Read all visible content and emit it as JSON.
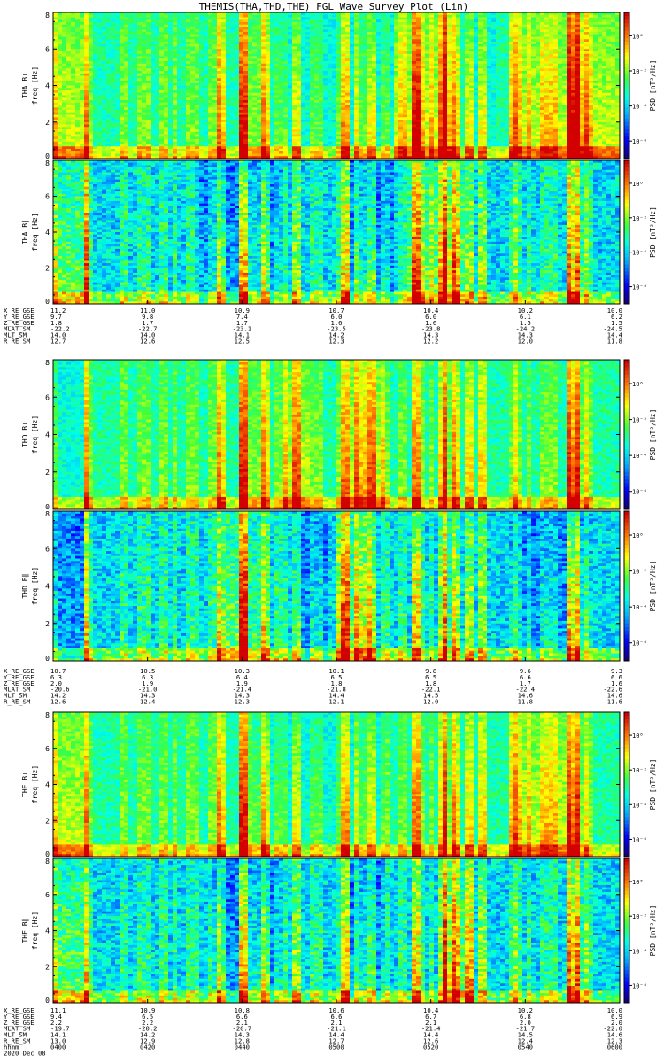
{
  "title": "THEMIS(THA,THD,THE) FGL Wave Survey Plot (Lin)",
  "colorbar_label": "PSD [nT²/Hz]",
  "colorbar_ticks": [
    "10⁰",
    "10⁻²",
    "10⁻⁴",
    "10⁻⁶"
  ],
  "chart_data": {
    "type": "heatmap",
    "colorscale": "rainbow",
    "zscale": "log",
    "ylim": [
      0,
      8
    ],
    "yticks": [
      "0",
      "2",
      "4",
      "6",
      "8"
    ],
    "groups": [
      {
        "probe": "THA",
        "panels": [
          {
            "id": "tha-bl",
            "ylabel": [
              "THA B⊥",
              "freq [Hz]"
            ],
            "component": "perp",
            "quiet_ranges": [
              [
                0.39,
                0.6
              ],
              [
                0.72,
                0.78
              ]
            ],
            "active_ranges": [
              [
                0.0,
                0.05
              ],
              [
                0.6,
                0.7
              ],
              [
                0.8,
                1.0
              ]
            ]
          },
          {
            "id": "tha-bll",
            "ylabel": [
              "THA B∥",
              "freq [Hz]"
            ],
            "component": "par",
            "quiet_ranges": [
              [
                0.25,
                0.4
              ],
              [
                0.52,
                0.6
              ]
            ],
            "active_ranges": [
              [
                0.0,
                0.06
              ],
              [
                0.62,
                0.72
              ]
            ]
          }
        ],
        "ephem_labels": [
          "X_RE_GSE",
          "Y_RE_GSE",
          "Z_RE_GSE",
          "MLAT_SM",
          "MLT_SM",
          "R_RE_SM"
        ],
        "ephem_columns": [
          [
            "11.2",
            "9.7",
            "1.8",
            "-22.2",
            "14.0",
            "12.7"
          ],
          [
            "11.0",
            "9.8",
            "1.7",
            "-22.7",
            "14.0",
            "12.6"
          ],
          [
            "10.9",
            "7.4",
            "1.7",
            "-23.1",
            "14.1",
            "12.5"
          ],
          [
            "10.7",
            "6.0",
            "1.6",
            "-23.5",
            "14.2",
            "12.3"
          ],
          [
            "10.4",
            "6.0",
            "1.6",
            "-23.8",
            "14.3",
            "12.2"
          ],
          [
            "10.2",
            "6.1",
            "1.5",
            "-24.2",
            "14.3",
            "12.0"
          ],
          [
            "10.0",
            "6.2",
            "1.5",
            "-24.5",
            "14.4",
            "11.8"
          ]
        ]
      },
      {
        "probe": "THD",
        "panels": [
          {
            "id": "thd-bl",
            "ylabel": [
              "THD B⊥",
              "freq [Hz]"
            ],
            "component": "perp",
            "quiet_ranges": [
              [
                0.0,
                0.05
              ]
            ],
            "active_ranges": [
              [
                0.52,
                0.58
              ],
              [
                0.4,
                0.45
              ]
            ]
          },
          {
            "id": "thd-bll",
            "ylabel": [
              "THD B∥",
              "freq [Hz]"
            ],
            "component": "par",
            "quiet_ranges": [
              [
                0.0,
                0.05
              ],
              [
                0.42,
                0.48
              ],
              [
                0.8,
                0.95
              ]
            ],
            "active_ranges": [
              [
                0.5,
                0.56
              ],
              [
                0.3,
                0.34
              ]
            ]
          }
        ],
        "ephem_labels": [
          "X_RE_GSE",
          "Y_RE_GSE",
          "Z_RE_GSE",
          "MLAT_SM",
          "MLT_SM",
          "R_RE_SM"
        ],
        "ephem_columns": [
          [
            "10.7",
            "6.3",
            "2.0",
            "-20.6",
            "14.2",
            "12.6"
          ],
          [
            "10.5",
            "6.3",
            "1.9",
            "-21.0",
            "14.3",
            "12.4"
          ],
          [
            "10.3",
            "6.4",
            "1.9",
            "-21.4",
            "14.3",
            "12.3"
          ],
          [
            "10.1",
            "6.5",
            "1.8",
            "-21.8",
            "14.4",
            "12.1"
          ],
          [
            "9.8",
            "6.5",
            "1.8",
            "-22.1",
            "14.5",
            "12.0"
          ],
          [
            "9.6",
            "6.6",
            "1.7",
            "-22.4",
            "14.6",
            "11.8"
          ],
          [
            "9.3",
            "6.6",
            "1.6",
            "-22.6",
            "14.6",
            "11.6"
          ]
        ]
      },
      {
        "probe": "THE",
        "panels": [
          {
            "id": "the-bl",
            "ylabel": [
              "THE B⊥",
              "freq [Hz]"
            ],
            "component": "perp",
            "quiet_ranges": [
              [
                0.35,
                0.55
              ],
              [
                0.55,
                0.58
              ]
            ],
            "active_ranges": [
              [
                0.0,
                0.05
              ],
              [
                0.8,
                0.9
              ]
            ]
          },
          {
            "id": "the-bll",
            "ylabel": [
              "THE B∥",
              "freq [Hz]"
            ],
            "component": "par",
            "quiet_ranges": [
              [
                0.28,
                0.4
              ],
              [
                0.52,
                0.58
              ]
            ],
            "active_ranges": [
              [
                0.0,
                0.05
              ],
              [
                0.68,
                0.74
              ]
            ]
          }
        ],
        "ephem_labels": [
          "X_RE_GSE",
          "Y_RE_GSE",
          "Z_RE_GSE",
          "MLAT_SM",
          "MLT_SM",
          "R_RE_SM",
          "hhmm",
          "2020 Dec 08"
        ],
        "ephem_columns": [
          [
            "11.1",
            "9.4",
            "2.2",
            "-19.7",
            "14.1",
            "13.0",
            "0400"
          ],
          [
            "10.9",
            "6.5",
            "2.2",
            "-20.2",
            "14.2",
            "12.9",
            "0420"
          ],
          [
            "10.8",
            "6.6",
            "2.1",
            "-20.7",
            "14.3",
            "12.8",
            "0440"
          ],
          [
            "10.6",
            "6.6",
            "2.1",
            "-21.1",
            "14.4",
            "12.7",
            "0500"
          ],
          [
            "10.4",
            "6.7",
            "2.1",
            "-21.4",
            "14.4",
            "12.6",
            "0520"
          ],
          [
            "10.2",
            "6.8",
            "2.0",
            "-21.7",
            "14.5",
            "12.4",
            "0540"
          ],
          [
            "10.0",
            "6.9",
            "2.0",
            "-22.0",
            "14.6",
            "12.3",
            "0600"
          ]
        ]
      }
    ]
  }
}
